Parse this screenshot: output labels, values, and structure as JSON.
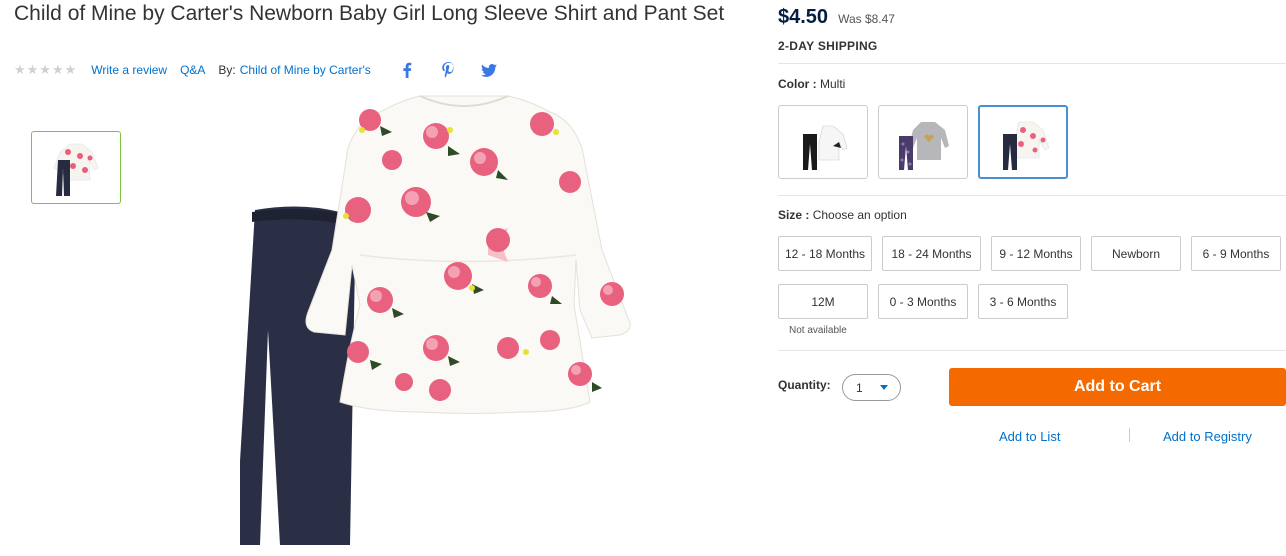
{
  "product": {
    "title": "Child of Mine by Carter's Newborn Baby Girl Long Sleeve Shirt and Pant Set",
    "stars": "★★★★★",
    "write_review": "Write a review",
    "qa": "Q&A",
    "by_label": "By:",
    "brand": "Child of Mine by Carter's"
  },
  "social": [
    "facebook-icon",
    "pinterest-icon",
    "twitter-icon"
  ],
  "pricing": {
    "price": "$4.50",
    "was": "Was $8.47",
    "shipping": "2-DAY SHIPPING"
  },
  "color": {
    "label": "Color :",
    "value": "Multi",
    "swatches": [
      "white-floral-set",
      "gray-heart-set",
      "floral-set"
    ],
    "selected_index": 2
  },
  "size": {
    "label": "Size :",
    "value": "Choose an option",
    "options_row1": [
      "12 - 18 Months",
      "18 - 24 Months",
      "9 - 12 Months",
      "Newborn",
      "6 - 9 Months"
    ],
    "options_row2": [
      "12M",
      "0 - 3 Months",
      "3 - 6 Months"
    ],
    "unavailable_note": "Not available"
  },
  "quantity": {
    "label": "Quantity:",
    "value": "1"
  },
  "actions": {
    "add_to_cart": "Add to Cart",
    "add_to_list": "Add to List",
    "add_to_registry": "Add to Registry"
  },
  "colors": {
    "accent_blue": "#0071ce",
    "cart_orange": "#f46a00",
    "thumb_border": "#7dc242",
    "selected_border": "#4b8ed1"
  }
}
